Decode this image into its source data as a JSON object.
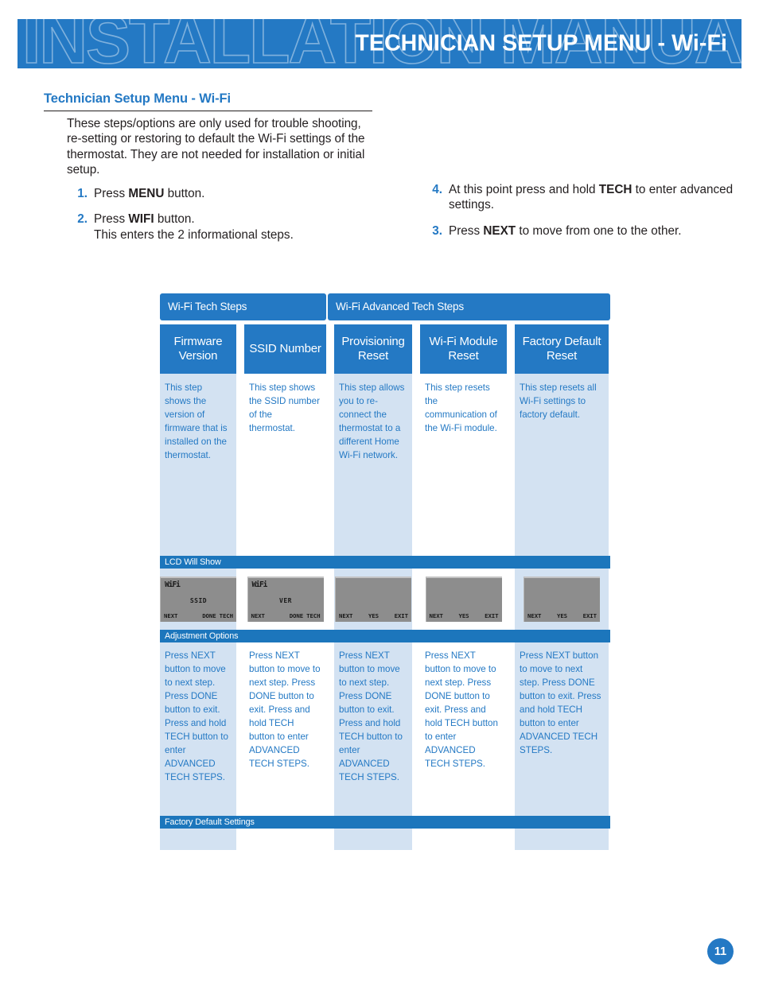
{
  "banner": {
    "watermark": "INSTALLATION MANUAL",
    "title": "TECHNICIAN SETUP MENU -  Wi-Fi",
    "bg_color": "#2479c4"
  },
  "section": {
    "heading": "Technician Setup Menu - Wi-Fi",
    "intro": "These steps/options are only used for trouble shooting, re-setting or restoring to default the Wi-Fi settings of the thermostat.  They are not needed for installation or initial setup."
  },
  "steps_left": [
    {
      "num": "1.",
      "pre": "Press ",
      "bold": "MENU",
      "post": " button."
    },
    {
      "num": "2.",
      "pre": "Press ",
      "bold": "WIFI",
      "post": " button.\nThis enters the 2 informational steps."
    }
  ],
  "steps_right": [
    {
      "num": "4.",
      "pre": "At this point press and hold ",
      "bold": "TECH",
      "post": " to enter advanced settings."
    },
    {
      "num": "3.",
      "pre": "Press ",
      "bold": "NEXT",
      "post": " to move from one to the other."
    }
  ],
  "table": {
    "group_headers": [
      {
        "label": "Wi-Fi Tech Steps",
        "span": 2
      },
      {
        "label": "Wi-Fi Advanced Tech Steps",
        "span": 3
      }
    ],
    "columns": [
      {
        "title": "Firmware\nVersion",
        "tinted": true,
        "description": "This step shows the version of firmware that is installed on the thermostat.",
        "lcd": {
          "wifi": "WiFi",
          "center": "SSID",
          "buttons": [
            "NEXT",
            "DONE",
            "TECH"
          ]
        },
        "adjustment": "Press NEXT button to move to next step.  Press DONE button to exit. Press and hold TECH button to enter ADVANCED TECH STEPS.",
        "factory_default": ""
      },
      {
        "title": "SSID Number",
        "tinted": false,
        "description": "This step shows the SSID number of the thermostat.",
        "lcd": {
          "wifi": "WiFi",
          "center": "VER",
          "buttons": [
            "NEXT",
            "DONE",
            "TECH"
          ]
        },
        "adjustment": "Press NEXT button to move to next step.  Press DONE button to exit. Press and hold TECH button to enter ADVANCED TECH STEPS.",
        "factory_default": ""
      },
      {
        "title": "Provisioning\nReset",
        "tinted": true,
        "description": "This step allows you to re-connect the thermostat to a different Home Wi-Fi network.",
        "lcd": {
          "wifi": "",
          "center": "",
          "buttons": [
            "NEXT",
            "YES",
            "EXIT"
          ]
        },
        "adjustment": "Press NEXT button to move to next step.  Press DONE button to exit. Press and hold TECH button to enter ADVANCED TECH STEPS.",
        "factory_default": ""
      },
      {
        "title": "Wi-Fi Module\nReset",
        "tinted": false,
        "description": "This step resets the communication of the Wi-Fi module.",
        "lcd": {
          "wifi": "",
          "center": "",
          "buttons": [
            "NEXT",
            "YES",
            "EXIT"
          ]
        },
        "adjustment": "Press NEXT button to move to next step.  Press DONE button to exit. Press and hold TECH button to enter ADVANCED TECH STEPS.",
        "factory_default": ""
      },
      {
        "title": "Factory Default\nReset",
        "tinted": true,
        "description": "This step resets all Wi-Fi settings to factory default.",
        "lcd": {
          "wifi": "",
          "center": "",
          "buttons": [
            "NEXT",
            "YES",
            "EXIT"
          ]
        },
        "adjustment": "Press NEXT button to move to next step.  Press DONE button to exit. Press and hold TECH button to enter ADVANCED TECH STEPS.",
        "factory_default": ""
      }
    ],
    "bands": {
      "lcd_will_show": "LCD Will Show",
      "adjustment_options": "Adjustment Options",
      "factory_default_settings": "Factory Default Settings"
    }
  },
  "page_number": "11"
}
